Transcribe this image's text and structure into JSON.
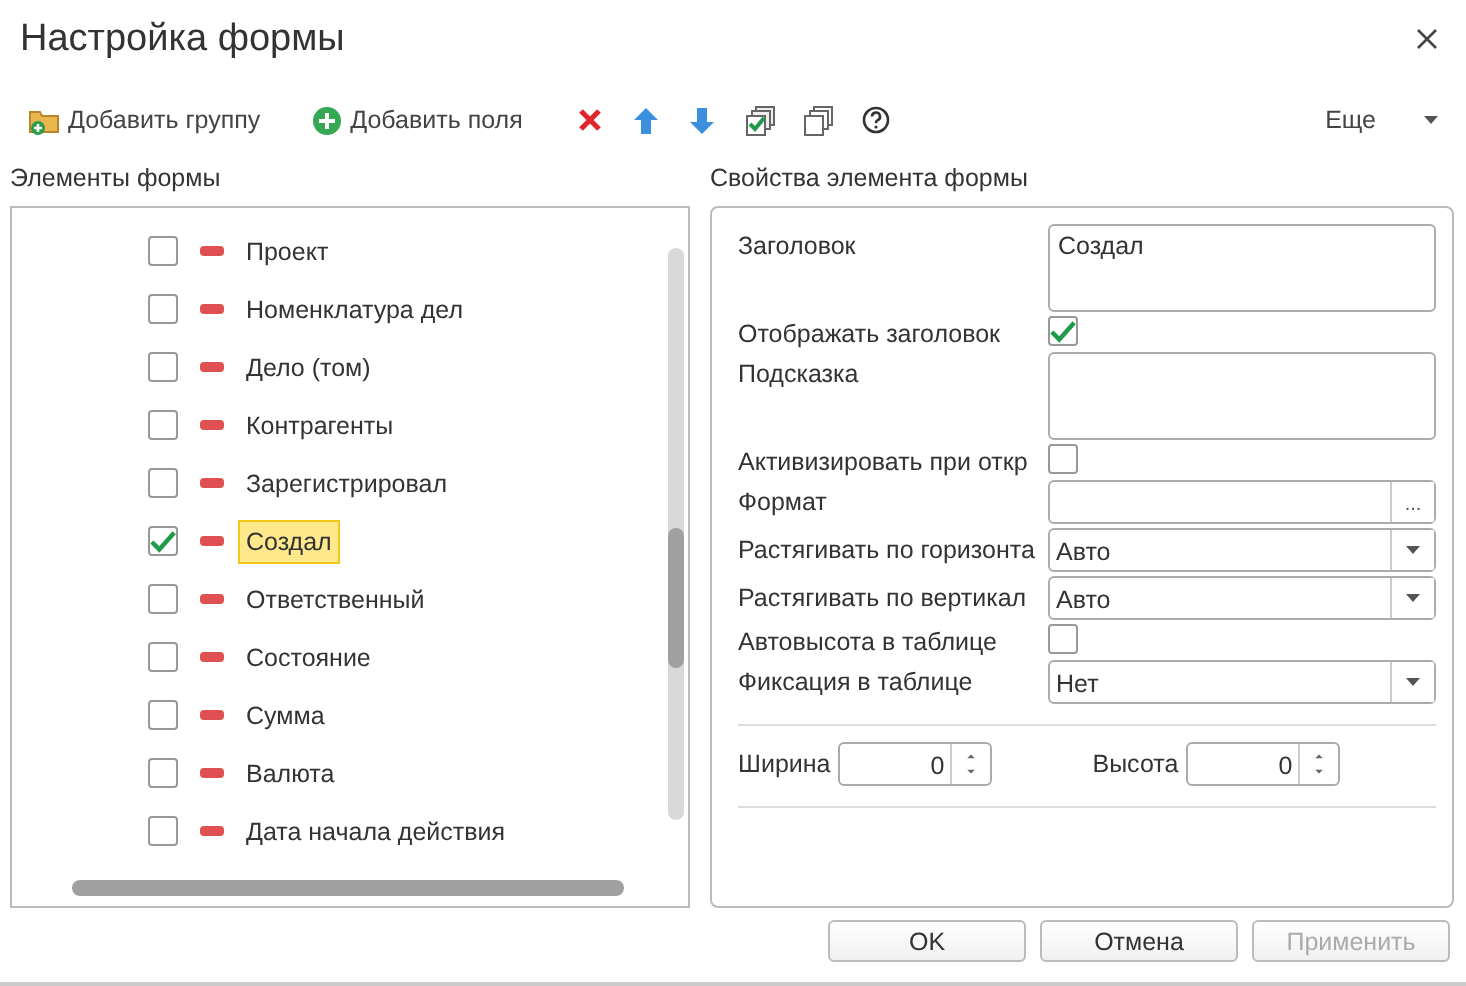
{
  "window": {
    "title": "Настройка формы"
  },
  "toolbar": {
    "items": [
      {
        "kind": "add-group",
        "label": "Добавить группу"
      },
      {
        "kind": "add-field",
        "label": "Добавить поля"
      },
      {
        "kind": "delete"
      },
      {
        "kind": "up"
      },
      {
        "kind": "down"
      },
      {
        "kind": "check-all"
      },
      {
        "kind": "uncheck-all"
      },
      {
        "kind": "help"
      }
    ],
    "more": "Еще"
  },
  "elements": {
    "heading": "Элементы формы",
    "items": [
      {
        "label": "Проект",
        "checked": false,
        "selected": false
      },
      {
        "label": "Номенклатура дел",
        "checked": false,
        "selected": false
      },
      {
        "label": "Дело (том)",
        "checked": false,
        "selected": false
      },
      {
        "label": "Контрагенты",
        "checked": false,
        "selected": false
      },
      {
        "label": "Зарегистрировал",
        "checked": false,
        "selected": false
      },
      {
        "label": "Создал",
        "checked": true,
        "selected": true
      },
      {
        "label": "Ответственный",
        "checked": false,
        "selected": false
      },
      {
        "label": "Состояние",
        "checked": false,
        "selected": false
      },
      {
        "label": "Сумма",
        "checked": false,
        "selected": false
      },
      {
        "label": "Валюта",
        "checked": false,
        "selected": false
      },
      {
        "label": "Дата начала действия",
        "checked": false,
        "selected": false
      }
    ]
  },
  "properties": {
    "heading": "Свойства элемента формы",
    "rows": [
      {
        "kind": "textarea",
        "label": "Заголовок",
        "value": "Создал"
      },
      {
        "kind": "checkbox",
        "label": "Отображать заголовок",
        "checked": true
      },
      {
        "kind": "textarea",
        "label": "Подсказка"
      },
      {
        "kind": "checkbox",
        "label": "Активизировать при откр",
        "checked": false
      },
      {
        "kind": "format",
        "label": "Формат",
        "button": "..."
      },
      {
        "kind": "select",
        "label": "Растягивать по горизонта",
        "value": "Авто"
      },
      {
        "kind": "select",
        "label": "Растягивать по вертикал",
        "value": "Авто"
      },
      {
        "kind": "checkbox",
        "label": "Автовысота в таблице",
        "checked": false
      },
      {
        "kind": "select",
        "label": "Фиксация в таблице",
        "value": "Нет"
      }
    ],
    "sizes": [
      {
        "label": "Ширина",
        "value": "0"
      },
      {
        "label": "Высота",
        "value": "0"
      }
    ]
  },
  "buttons": [
    {
      "label": "OK",
      "disabled": false
    },
    {
      "label": "Отмена",
      "disabled": false
    },
    {
      "label": "Применить",
      "disabled": true
    }
  ]
}
